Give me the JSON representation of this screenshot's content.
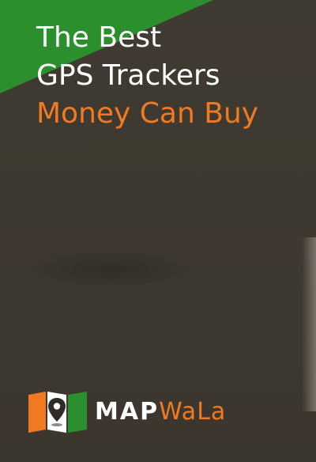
{
  "headline": {
    "line1": "The Best",
    "line2": "GPS Trackers",
    "line3": "Money Can Buy"
  },
  "brand": {
    "name_part1": "MAP",
    "name_part2": "WaLa",
    "logo_icon": "location-pin-icon"
  },
  "colors": {
    "background": "#3f3a31",
    "accent_green": "#2a8f2c",
    "accent_orange": "#f07a21",
    "text_white": "#ffffff"
  }
}
